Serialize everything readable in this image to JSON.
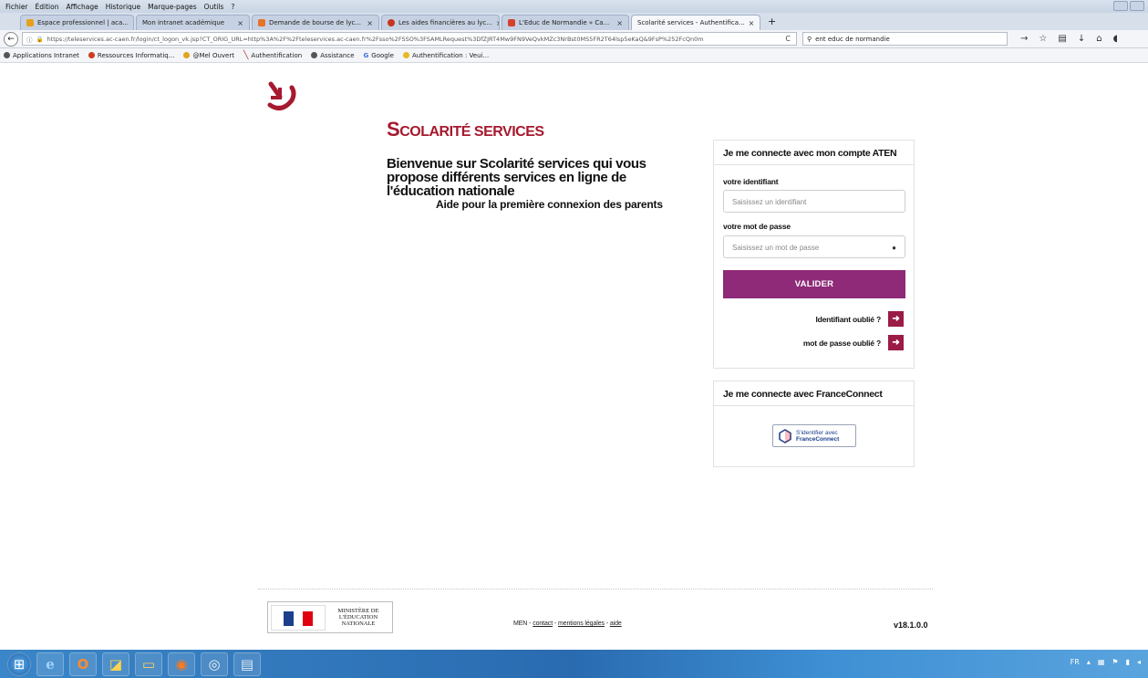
{
  "browser": {
    "menu": [
      "Fichier",
      "Édition",
      "Affichage",
      "Historique",
      "Marque-pages",
      "Outils",
      "?"
    ],
    "tabs": [
      {
        "label": "Espace professionnel | aca...",
        "color": "#e3a21a",
        "active": false
      },
      {
        "label": "Mon intranet académique",
        "color": "#7f99c4",
        "active": false
      },
      {
        "label": "Demande de bourse de lyc...",
        "color": "#e6732a",
        "active": false
      },
      {
        "label": "Les aides financières au lyc...",
        "color": "#c9331d",
        "active": false
      },
      {
        "label": "L'Educ de Normandie » Ca...",
        "color": "#d6412e",
        "active": false
      },
      {
        "label": "Scolarité services - Authentifica...",
        "color": "#4c76b6",
        "active": true
      }
    ],
    "new_tab": "+",
    "url": "https://teleservices.ac-caen.fr/login/ct_logon_vk.jsp?CT_ORIG_URL=http%3A%2F%2Fteleservices.ac-caen.fr%2Fsso%2FSSO%3FSAMLRequest%3DfZJRT4Mw9FN9VeQvkMZc3NrBst0MS5FR2T64lsp5eKaQ&9FsP%252FcQn0m",
    "search": "ent educ de normandie",
    "bookmarks": [
      {
        "label": "Applications Intranet",
        "color": "#555555"
      },
      {
        "label": "Ressources Informatiq...",
        "color": "#d13b1f"
      },
      {
        "label": "@Mel Ouvert",
        "color": "#e3a21a"
      },
      {
        "label": "Authentification",
        "color": "#b2302c"
      },
      {
        "label": "Assistance",
        "color": "#555555"
      },
      {
        "label": "Google",
        "color": "#3b6fd8"
      },
      {
        "label": "Authentification : Veui...",
        "color": "#e8b81f"
      }
    ]
  },
  "page": {
    "title_first": "S",
    "title_rest": "COLARITÉ SERVICES",
    "welcome": "Bienvenue sur Scolarité services qui vous propose différents services en ligne de l'éducation nationale",
    "help_link": "Aide pour la première connexion des parents",
    "aten": {
      "heading": "Je me connecte avec mon compte ATEN",
      "id_label": "votre identifiant",
      "id_placeholder": "Saisissez un identifiant",
      "pw_label": "votre mot de passe",
      "pw_placeholder": "Saisissez un mot de passe",
      "submit": "VALIDER",
      "forgot_id": "Identifiant oublié ?",
      "forgot_pw": "mot de passe oublié ?"
    },
    "franceconnect": {
      "heading": "Je me connecte avec FranceConnect",
      "button_line1": "S'identifier avec",
      "button_line2": "FranceConnect"
    }
  },
  "footer": {
    "ministry": "MINISTÈRE DE L'ÉDUCATION NATIONALE",
    "links_prefix": "MEN - ",
    "contact": "contact",
    "sep": " - ",
    "legal": "mentions légales",
    "help": "aide",
    "version": "v18.1.0.0"
  },
  "colors": {
    "brand_red": "#a6192e",
    "submit_purple": "#8e2a78",
    "arrow_button": "#9a1b46"
  },
  "taskbar": {
    "icons": [
      "start-orb-icon",
      "internet-explorer-icon",
      "outlook-icon",
      "libreoffice-icon",
      "file-explorer-icon",
      "firefox-icon",
      "chrome-icon",
      "notepad-icon"
    ],
    "tray_lang": "FR"
  }
}
